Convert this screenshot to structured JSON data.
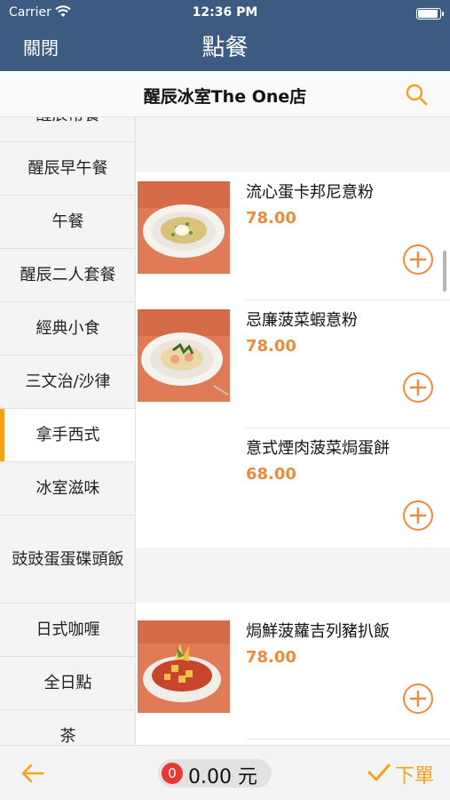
{
  "status_bar": {
    "carrier": "Carrier",
    "time": "12:36 PM"
  },
  "nav": {
    "close_label": "關閉",
    "title": "點餐"
  },
  "store": {
    "name": "醒辰冰室The One店"
  },
  "categories": [
    {
      "label": "醒辰常餐",
      "active": false
    },
    {
      "label": "醒辰早午餐",
      "active": false
    },
    {
      "label": "午餐",
      "active": false
    },
    {
      "label": "醒辰二人套餐",
      "active": false
    },
    {
      "label": "經典小食",
      "active": false
    },
    {
      "label": "三文治/沙律",
      "active": false
    },
    {
      "label": "拿手西式",
      "active": true
    },
    {
      "label": "冰室滋味",
      "active": false
    },
    {
      "label": "豉豉蛋蛋碟頭飯",
      "active": false
    },
    {
      "label": "日式咖喱",
      "active": false
    },
    {
      "label": "全日點",
      "active": false
    },
    {
      "label": "茶",
      "active": false
    }
  ],
  "menu_items": [
    {
      "name": "流心蛋卡邦尼意粉",
      "price": "78.00",
      "has_image": true,
      "image": "carbonara"
    },
    {
      "name": "忌廉菠菜蝦意粉",
      "price": "78.00",
      "has_image": true,
      "image": "shrimp-pasta"
    },
    {
      "name": "意式煙肉菠菜焗蛋餅",
      "price": "68.00",
      "has_image": false
    },
    {
      "name": "焗鮮菠蘿吉列豬扒飯",
      "price": "78.00",
      "has_image": true,
      "image": "pork-chop-rice"
    }
  ],
  "cart": {
    "count": "0",
    "total": "0.00 元"
  },
  "bottom": {
    "order_label": "下單"
  },
  "colors": {
    "nav_bg": "#3d5a80",
    "accent": "#f5a21b",
    "price": "#ee8a3a",
    "badge": "#e53935"
  }
}
